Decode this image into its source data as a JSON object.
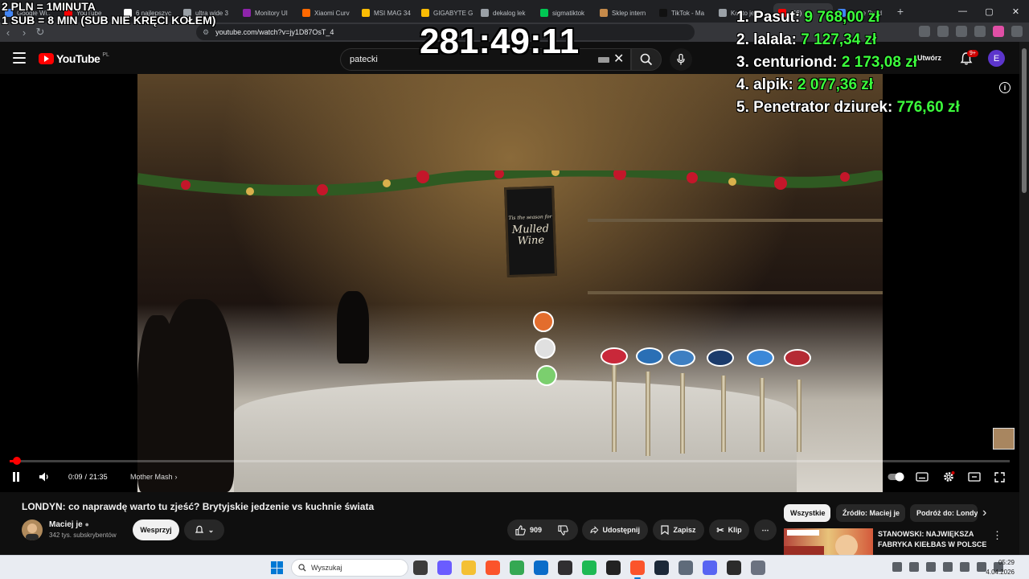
{
  "overlay": {
    "info_line1": "2 PLN = 1MINUTA",
    "info_line2": "1 SUB = 8 MIN (SUB NIE KRĘCI KOŁEM)",
    "timer": "281:49:11",
    "leaderboard": [
      {
        "rank": "1.",
        "name": "Pasut:",
        "amount": "9 768,00 zł"
      },
      {
        "rank": "2.",
        "name": "lalala:",
        "amount": "7 127,34 zł"
      },
      {
        "rank": "3.",
        "name": "centuriond:",
        "amount": "2 173,08 zł"
      },
      {
        "rank": "4.",
        "name": "alpik:",
        "amount": "2 077,36 zł"
      },
      {
        "rank": "5.",
        "name": "Penetrator dziurek:",
        "amount": "776,60 zł"
      }
    ],
    "colors": {
      "amount": "#3cff3c",
      "text": "#ffffff"
    }
  },
  "browser": {
    "tabs": [
      {
        "label": "Google Wi..",
        "color": "#4285f4"
      },
      {
        "label": "YouTube",
        "color": "#ff0000"
      },
      {
        "label": "6 najlepszyc",
        "color": "#ffffff"
      },
      {
        "label": "ultra wide 3",
        "color": "#9aa0a6"
      },
      {
        "label": "Monitory UI",
        "color": "#8e24aa"
      },
      {
        "label": "Xiaomi Curv",
        "color": "#ff6900"
      },
      {
        "label": "MSI MAG 34",
        "color": "#fbbc04"
      },
      {
        "label": "GIGABYTE G",
        "color": "#fbbc04"
      },
      {
        "label": "dekalog lek",
        "color": "#9aa0a6"
      },
      {
        "label": "sigmatiktok",
        "color": "#00c853"
      },
      {
        "label": "Sklep intern",
        "color": "#c58a4a"
      },
      {
        "label": "TikTok - Ma",
        "color": "#111111"
      },
      {
        "label": "Konto je",
        "color": "#9aa0a6"
      },
      {
        "label": "(56)",
        "color": "#ff0000"
      },
      {
        "label": "Anive Build",
        "color": "#4285f4"
      }
    ],
    "new_tab": "+",
    "url": "youtube.com/watch?v=jy1D87OsT_4",
    "win_min": "—",
    "win_max": "▢",
    "win_close": "✕"
  },
  "youtube": {
    "logo_text": "YouTube",
    "region": "PL",
    "search_value": "patecki",
    "notification_count": "9+",
    "avatar_letter": "E",
    "upload_label": "Utwórz"
  },
  "player": {
    "progress_fraction": 0.007,
    "time_current": "0:09",
    "time_sep": "/",
    "time_total": "21:35",
    "chapter": "Mother Mash",
    "mulled_top": "Tis the season for",
    "mulled_line1": "Mulled",
    "mulled_line2": "Wine"
  },
  "video_info": {
    "title": "LONDYN: co naprawdę warto tu zjeść? Brytyjskie jedzenie vs kuchnie świata",
    "channel_name": "Maciej je",
    "subscribers": "342 tys. subskrybentów",
    "support_label": "Wesprzyj",
    "likes": "909",
    "share_label": "Udostępnij",
    "save_label": "Zapisz",
    "clip_label": "Klip",
    "more_label": "⋯"
  },
  "sidebar": {
    "chips": [
      {
        "label": "Wszystkie",
        "selected": true
      },
      {
        "label": "Źródło: Maciej je",
        "selected": false
      },
      {
        "label": "Podróż do: Londyn",
        "selected": false
      }
    ],
    "next_arrow": "›",
    "rec_title": "STANOWSKI: NAJWIĘKSZA FABRYKA KIEŁBAS W POLSCE",
    "rec_more": "⋮"
  },
  "taskbar": {
    "search_placeholder": "Wyszukaj",
    "time": "05:29",
    "date": "4.04.2026",
    "apps": [
      {
        "name": "task-view",
        "color": "#3c3c3c"
      },
      {
        "name": "copilot",
        "color": "#6a5cff"
      },
      {
        "name": "file-explorer",
        "color": "#f4c033"
      },
      {
        "name": "brave",
        "color": "#fb542b"
      },
      {
        "name": "chrome",
        "color": "#34a853"
      },
      {
        "name": "store",
        "color": "#0a6cc9"
      },
      {
        "name": "obs",
        "color": "#302e31"
      },
      {
        "name": "spotify",
        "color": "#1db954"
      },
      {
        "name": "media",
        "color": "#222222"
      },
      {
        "name": "brave-active",
        "color": "#fb542b"
      },
      {
        "name": "steam",
        "color": "#1b2838"
      },
      {
        "name": "calculator",
        "color": "#5f6b7a"
      },
      {
        "name": "discord",
        "color": "#5865f2"
      },
      {
        "name": "app-dark",
        "color": "#2b2b2b"
      },
      {
        "name": "settings",
        "color": "#6b7280"
      }
    ]
  }
}
